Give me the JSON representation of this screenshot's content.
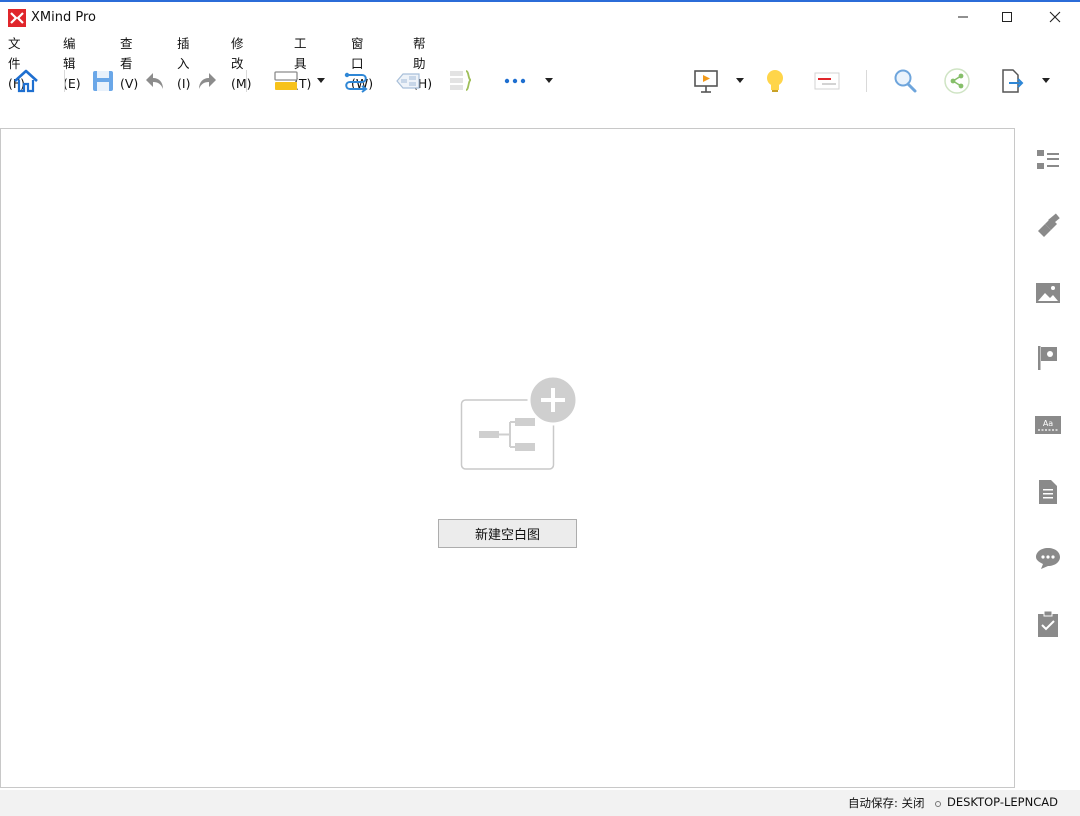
{
  "window": {
    "title": "XMind Pro",
    "accent_color": "#2b6cd8",
    "logo_color": "#e0262b"
  },
  "menu": {
    "items": [
      {
        "label": "文件(F)"
      },
      {
        "label": "编辑(E)"
      },
      {
        "label": "查看(V)"
      },
      {
        "label": "插入(I)"
      },
      {
        "label": "修改(M)"
      },
      {
        "label": "工具(T)"
      },
      {
        "label": "窗口(W)"
      },
      {
        "label": "帮助(H)"
      }
    ]
  },
  "toolbar": {
    "icons": [
      "home-icon",
      "save-icon",
      "undo-icon",
      "redo-icon",
      "topic-icon",
      "relationship-icon",
      "boundary-icon",
      "summary-icon",
      "more-icon",
      "presentation-icon",
      "brainstorm-icon",
      "gantt-icon",
      "search-icon",
      "share-icon",
      "export-icon"
    ]
  },
  "canvas": {
    "new_blank_button": "新建空白图"
  },
  "side_panel": {
    "icons": [
      "outline-icon",
      "format-brush-icon",
      "image-icon",
      "marker-flag-icon",
      "text-style-icon",
      "notes-icon",
      "comments-icon",
      "task-icon"
    ]
  },
  "status": {
    "autosave": "自动保存: 关闭",
    "machine": "DESKTOP-LEPNCAD"
  }
}
